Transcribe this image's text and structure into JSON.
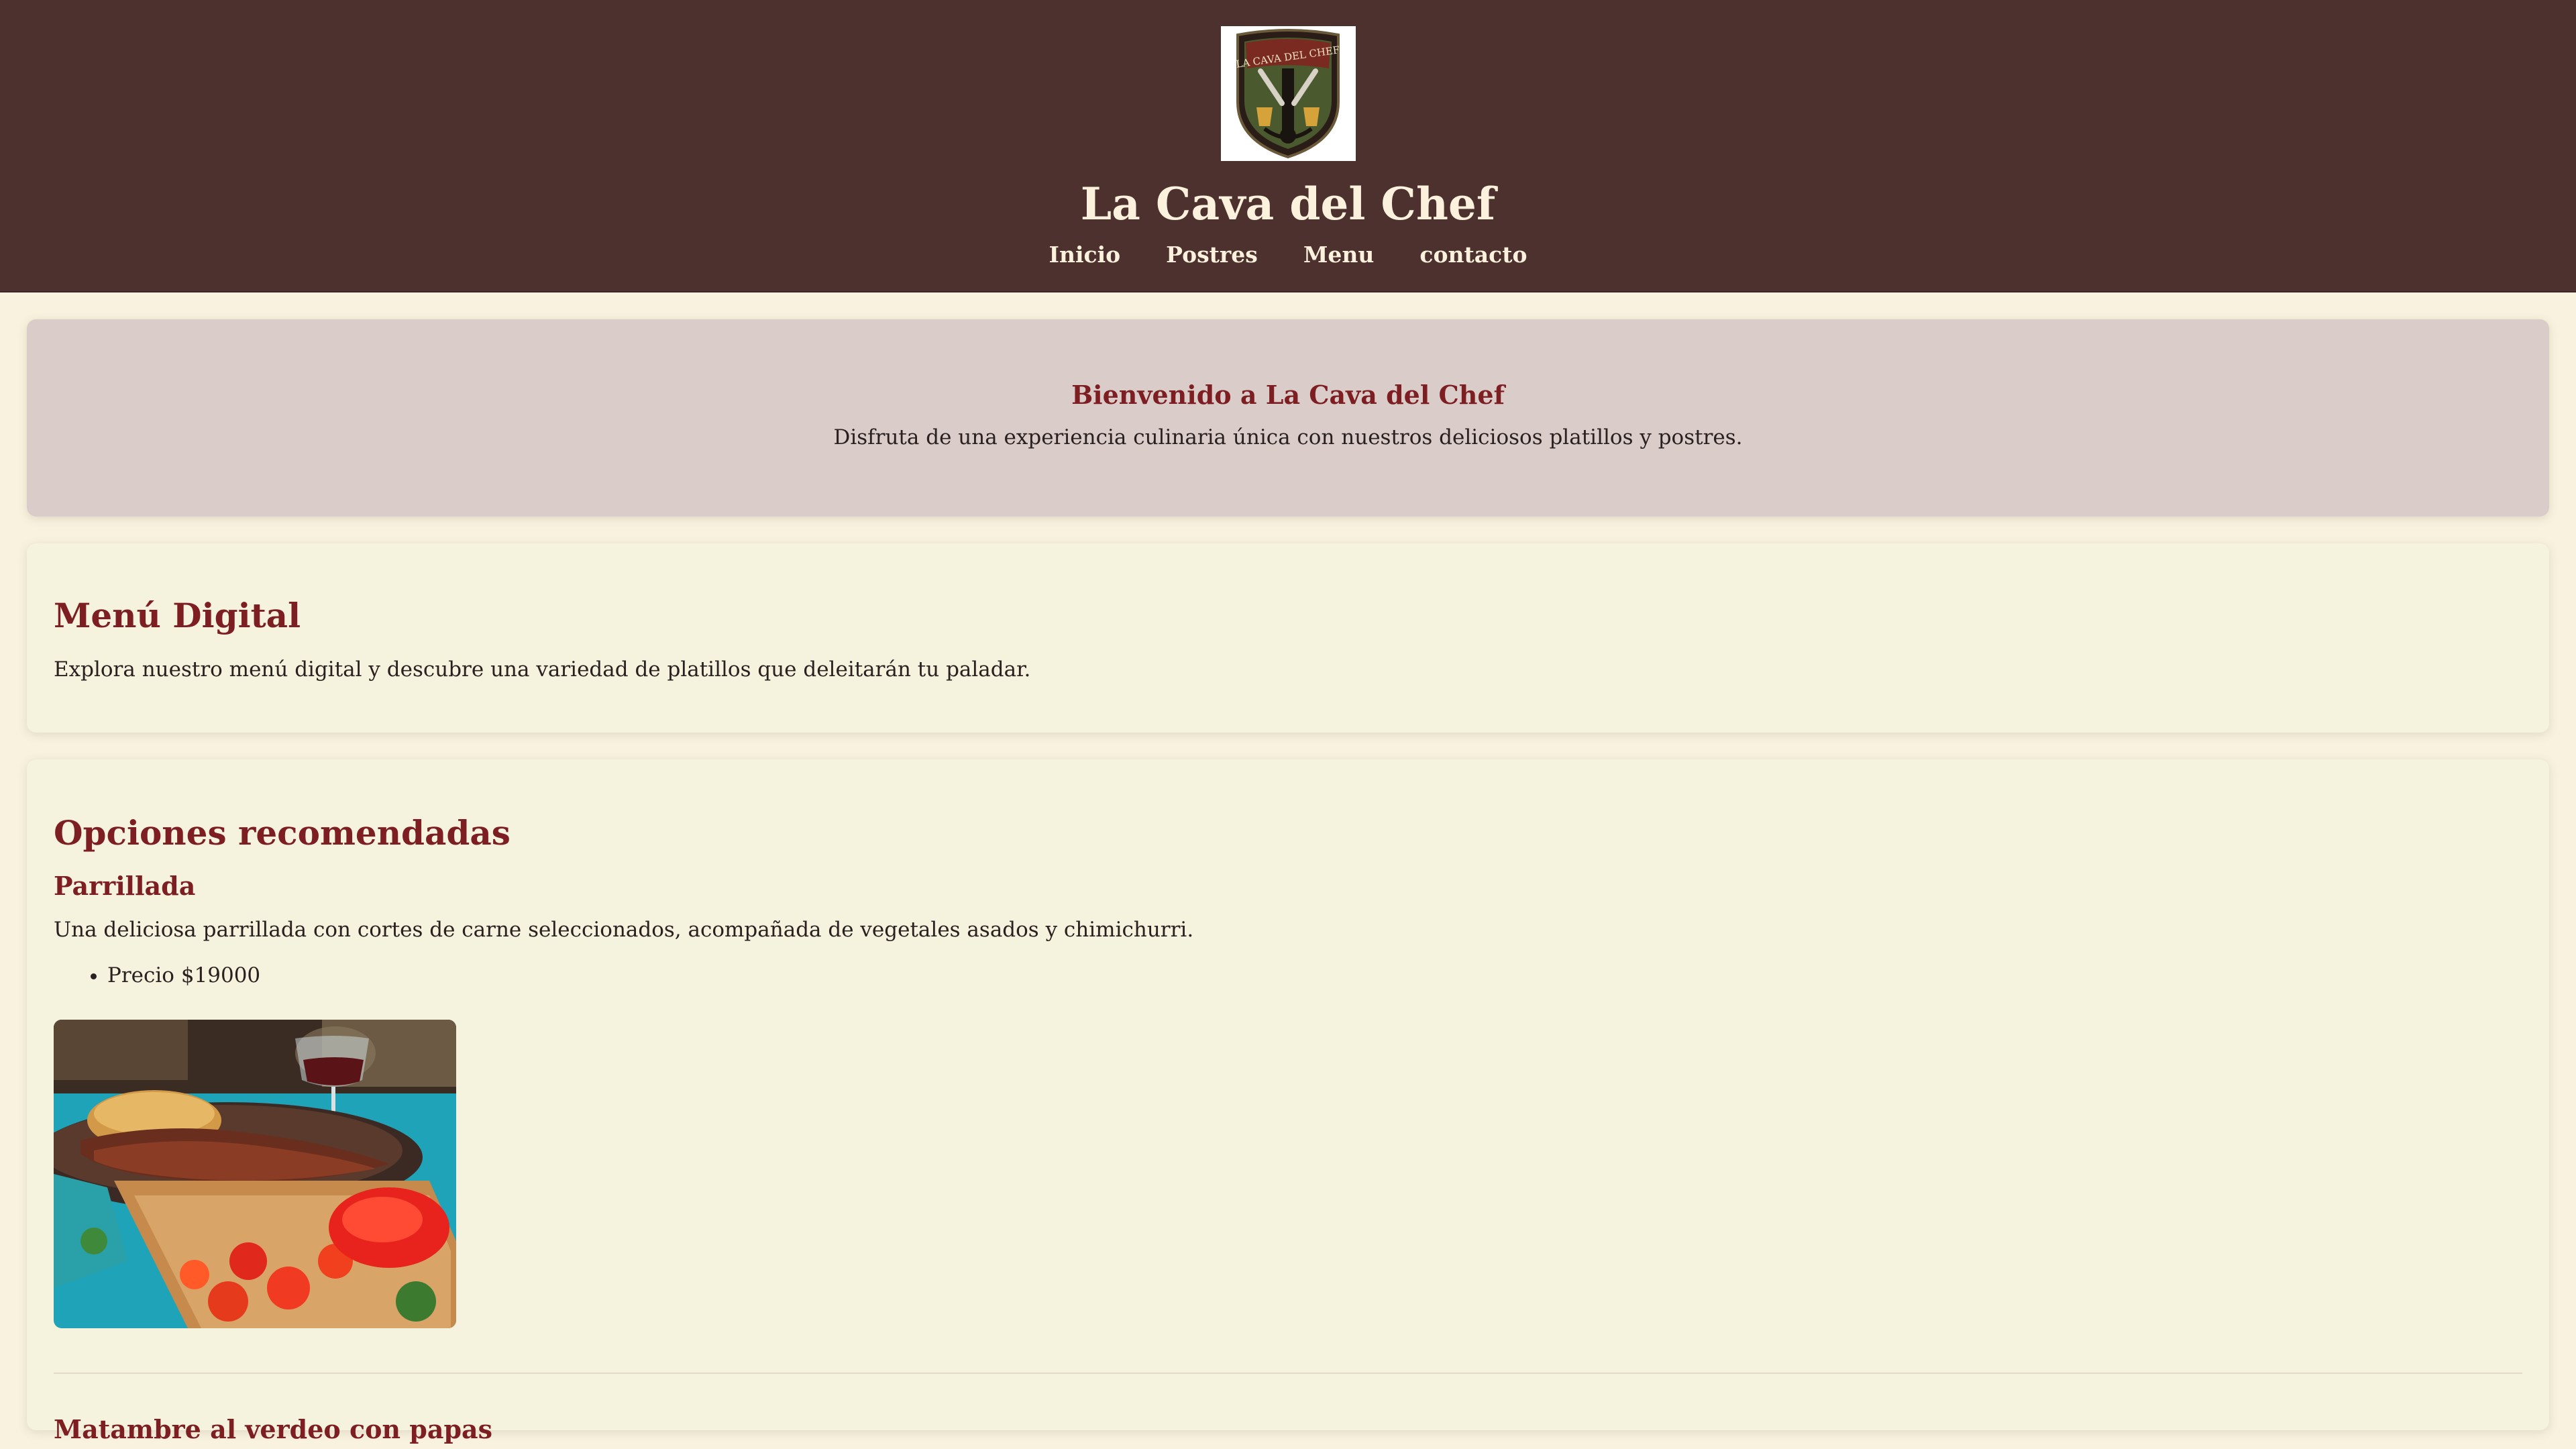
{
  "header": {
    "logo_text": "La Cava del Chef",
    "title": "La Cava del Chef",
    "nav": [
      {
        "label": "Inicio"
      },
      {
        "label": "Postres"
      },
      {
        "label": "Menu"
      },
      {
        "label": "contacto"
      }
    ]
  },
  "welcome": {
    "title": "Bienvenido a La Cava del Chef",
    "text": "Disfruta de una experiencia culinaria única con nuestros deliciosos platillos y postres."
  },
  "menu": {
    "title": "Menú Digital",
    "text": "Explora nuestro menú digital y descubre una variedad de platillos que deleitarán tu paladar."
  },
  "options": {
    "title": "Opciones recomendadas",
    "dishes": [
      {
        "name": "Parrillada",
        "description": "Una deliciosa parrillada con cortes de carne seleccionados, acompañada de vegetales asados y chimichurri.",
        "price": "Precio $19000"
      },
      {
        "name": "Matambre al verdeo con papas"
      }
    ]
  },
  "colors": {
    "header_bg": "#4d312e",
    "accent": "#7d1e22",
    "page_bg": "#f8f2df",
    "card_bg": "#f5f3de",
    "welcome_bg": "#d9ccc9"
  }
}
